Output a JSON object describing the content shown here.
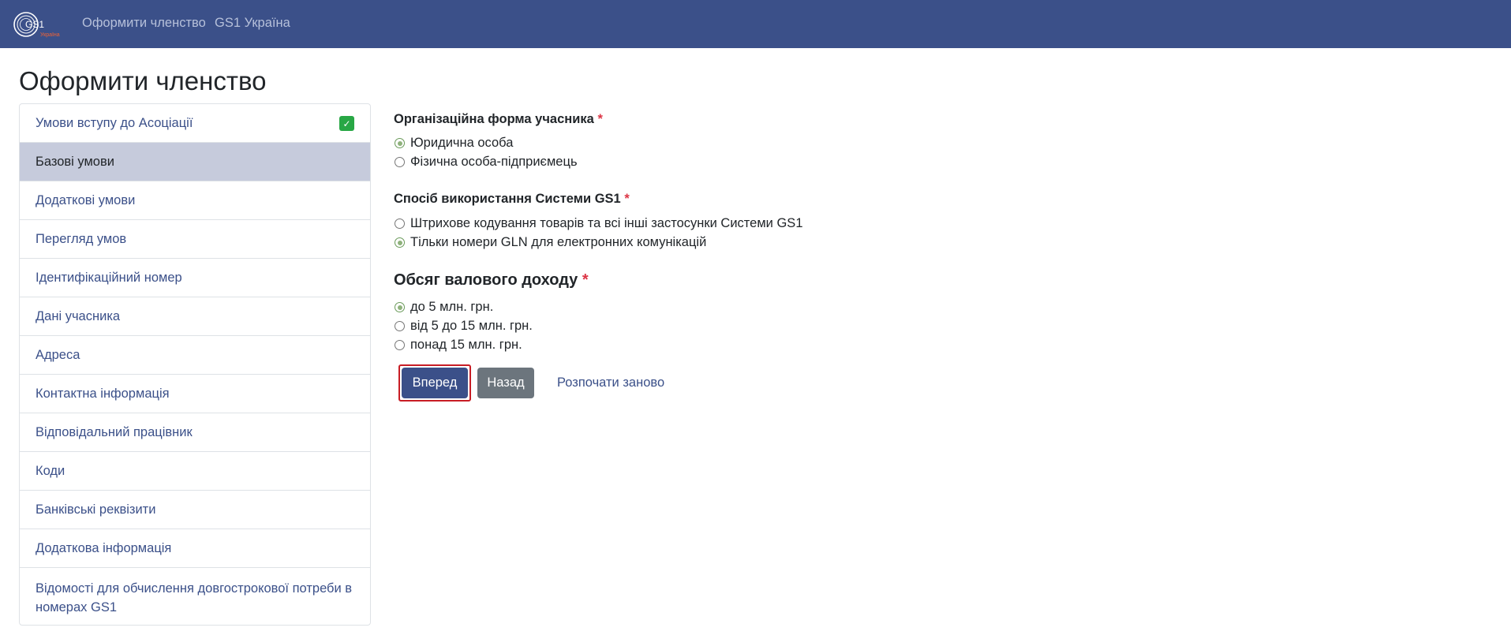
{
  "navbar": {
    "logo_text": "GS1",
    "logo_sub": "Україна",
    "links": [
      "Оформити членство",
      "GS1 Україна"
    ]
  },
  "page_title": "Оформити членство",
  "sidebar": {
    "items": [
      {
        "label": "Умови вступу до Асоціації",
        "completed": true,
        "check": "✓"
      },
      {
        "label": "Базові умови",
        "active": true
      },
      {
        "label": "Додаткові умови"
      },
      {
        "label": "Перегляд умов"
      },
      {
        "label": "Ідентифікаційний номер"
      },
      {
        "label": "Дані учасника"
      },
      {
        "label": "Адреса"
      },
      {
        "label": "Контактна інформація"
      },
      {
        "label": "Відповідальний працівник"
      },
      {
        "label": "Коди"
      },
      {
        "label": "Банківські реквізити"
      },
      {
        "label": "Додаткова інформація"
      },
      {
        "label": "Відомості для обчислення довгострокової потреби в номерах GS1"
      }
    ]
  },
  "form": {
    "required_mark": "*",
    "org_form": {
      "label": "Організаційна форма учасника",
      "options": [
        {
          "label": "Юридична особа",
          "checked": true
        },
        {
          "label": "Фізична особа-підприємець",
          "checked": false
        }
      ]
    },
    "usage": {
      "label": "Спосіб використання Системи GS1",
      "options": [
        {
          "label": "Штрихове кодування товарів та всі інші застосунки Системи GS1",
          "checked": false
        },
        {
          "label": "Тільки номери GLN для електронних комунікацій",
          "checked": true
        }
      ]
    },
    "income": {
      "label": "Обсяг валового доходу",
      "options": [
        {
          "label": "до 5 млн. грн.",
          "checked": true
        },
        {
          "label": "від 5 до 15 млн. грн.",
          "checked": false
        },
        {
          "label": "понад 15 млн. грн.",
          "checked": false
        }
      ]
    },
    "buttons": {
      "next": "Вперед",
      "back": "Назад",
      "restart": "Розпочати заново"
    }
  },
  "colors": {
    "navbar": "#3b5089",
    "active_step": "#c6cbdc",
    "check": "#28a745",
    "required": "#dc3545",
    "focus_outline": "#c81d25"
  }
}
